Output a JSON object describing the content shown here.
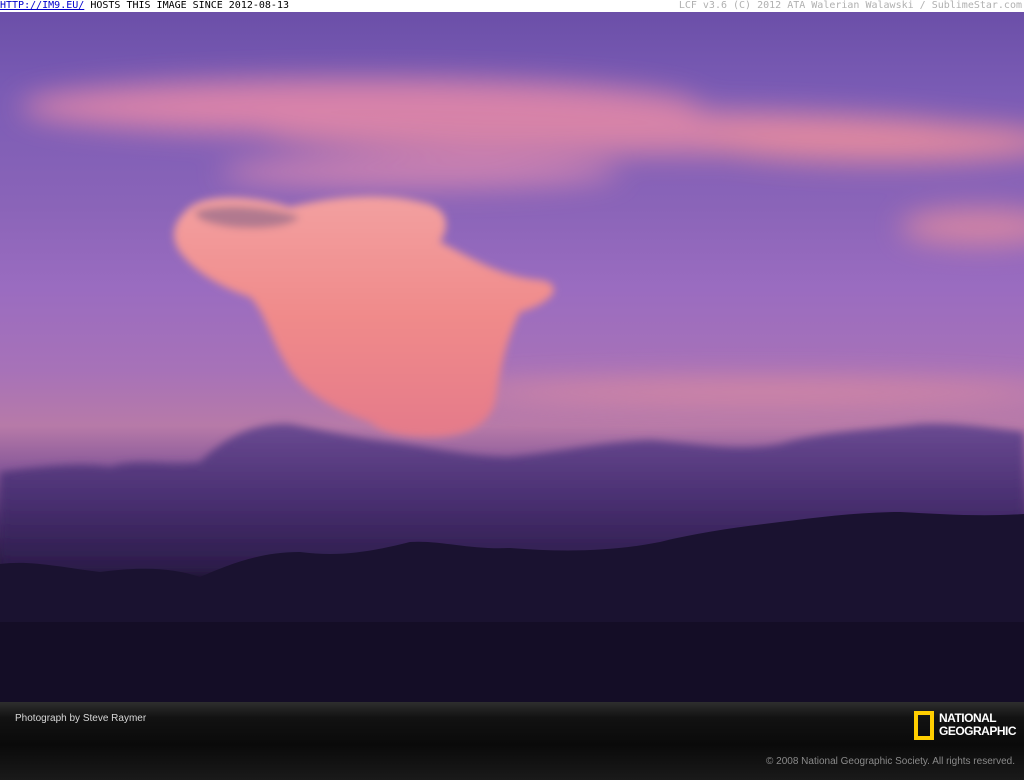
{
  "topbar": {
    "link_text": "HTTP://IM9.EU/",
    "host_text": " HOSTS THIS IMAGE SINCE 2012-08-13",
    "right_text": "LCF v3.6 (C) 2012 ATA Walerian Walawski / SublimeStar.com"
  },
  "footer": {
    "credit": "Photograph by Steve Raymer",
    "logo_line1": "NATIONAL",
    "logo_line2": "GEOGRAPHIC",
    "copyright": "© 2008 National Geographic Society. All rights reserved."
  },
  "colors": {
    "logo_frame": "#ffce00",
    "sky_top": "#6b4fa8",
    "cloud_pink": "#f08a8a"
  },
  "icons": {
    "logo": "national-geographic-yellow-frame"
  }
}
